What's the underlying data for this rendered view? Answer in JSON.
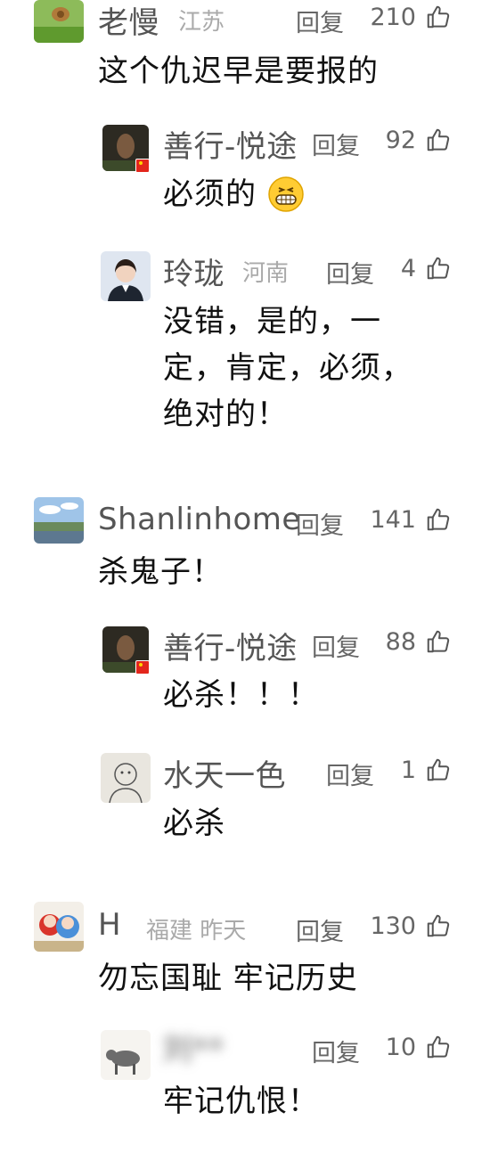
{
  "threads": [
    {
      "name": "老慢",
      "location": "江苏",
      "reply_label": "回复",
      "likes": "210",
      "content": "这个仇迟早是要报的",
      "replies": [
        {
          "name": "善行-悦途",
          "reply_label": "回复",
          "likes": "92",
          "content": "必须的"
        },
        {
          "name": "玲珑",
          "location": "河南",
          "reply_label": "回复",
          "likes": "4",
          "content": "没错，是的，一\n定，肯定，必须，\n绝对的！"
        }
      ]
    },
    {
      "name": "Shanlinhome",
      "reply_label": "回复",
      "likes": "141",
      "content": "杀鬼子！",
      "replies": [
        {
          "name": "善行-悦途",
          "reply_label": "回复",
          "likes": "88",
          "content": "必杀！！！"
        },
        {
          "name": "水天一色",
          "reply_label": "回复",
          "likes": "1",
          "content": "必杀"
        }
      ]
    },
    {
      "name": "H",
      "location": "福建 昨天",
      "reply_label": "回复",
      "likes": "130",
      "content": "勿忘国耻 牢记历史",
      "replies": [
        {
          "name": "刘**",
          "reply_label": "回复",
          "likes": "10",
          "content": "牢记仇恨！"
        }
      ]
    }
  ],
  "icons": {
    "like": "thumbs-up-icon",
    "emoji": "grinning-emoji"
  },
  "colors": {
    "text": "#111111",
    "meta": "#666666",
    "location": "#aaaaaa"
  }
}
